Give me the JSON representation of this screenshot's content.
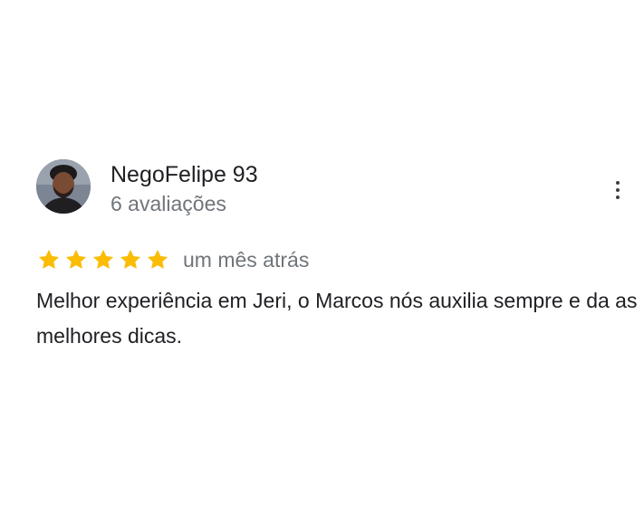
{
  "review": {
    "author_name": "NegoFelipe 93",
    "review_count": "6 avaliações",
    "rating": 5,
    "max_rating": 5,
    "date": "um mês atrás",
    "text": "Melhor experiência em Jeri, o Marcos nós auxilia sempre e da as melhores dicas.",
    "avatar_icon": "user-avatar-photo",
    "more_icon": "more-vert-icon",
    "star_icon": "star-icon"
  },
  "colors": {
    "star": "#fbbc04",
    "name": "#202124",
    "secondary": "#70757a"
  }
}
